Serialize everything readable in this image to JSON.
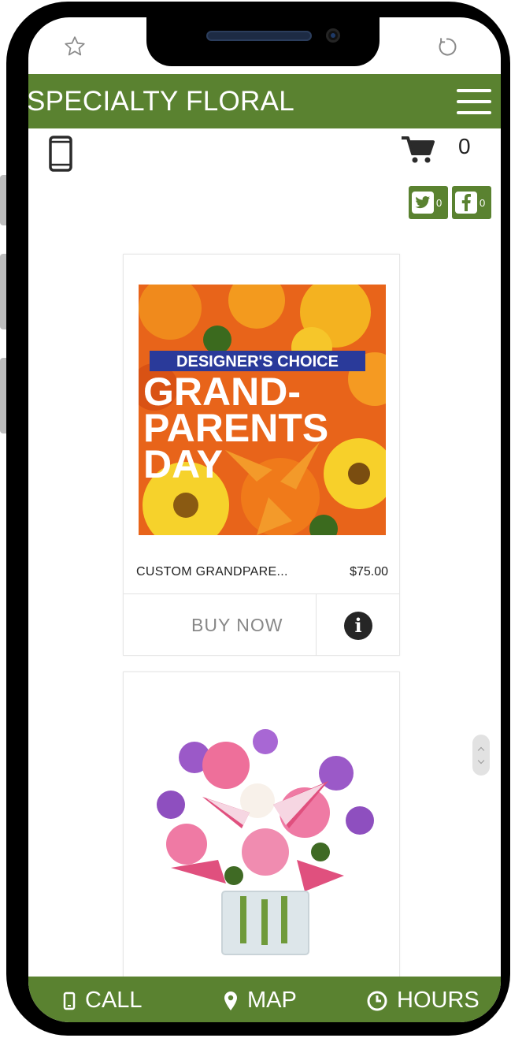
{
  "header": {
    "title": "SPECIALTY FLORAL"
  },
  "cart": {
    "count": "0"
  },
  "social": {
    "twitter_count": "0",
    "facebook_count": "0"
  },
  "products": [
    {
      "name": "CUSTOM GRANDPARE...",
      "price": "$75.00",
      "buy_label": "BUY NOW",
      "image_banner": "DESIGNER'S CHOICE",
      "image_headline_1": "GRAND-",
      "image_headline_2": "PARENTS",
      "image_headline_3": "DAY"
    },
    {
      "name": "",
      "price": ""
    }
  ],
  "bottom_bar": {
    "call": "CALL",
    "map": "MAP",
    "hours": "HOURS"
  },
  "icons": [
    "star-icon",
    "refresh-icon",
    "hamburger-menu-icon",
    "mobile-phone-icon",
    "cart-icon",
    "twitter-icon",
    "facebook-icon",
    "info-icon",
    "map-pin-icon",
    "clock-icon"
  ],
  "colors": {
    "brand_green": "#5a8230",
    "text_dark": "#222222",
    "button_text": "#888888"
  }
}
